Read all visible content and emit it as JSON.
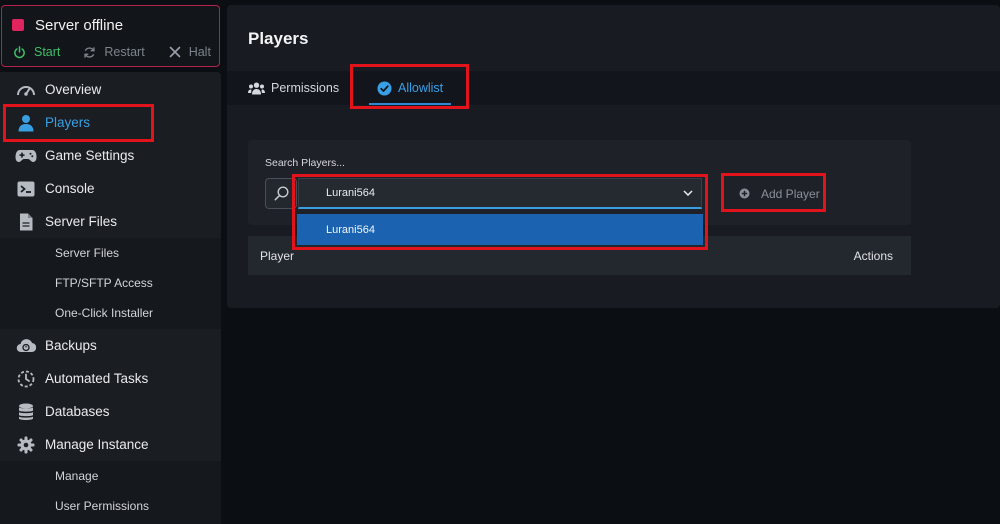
{
  "server": {
    "status": "Server offline"
  },
  "power": {
    "start": "Start",
    "restart": "Restart",
    "halt": "Halt"
  },
  "sidebar": {
    "overview": "Overview",
    "players": "Players",
    "game_settings": "Game Settings",
    "console": "Console",
    "server_files": "Server Files",
    "server_files_sub": [
      "Server Files",
      "FTP/SFTP Access",
      "One-Click Installer"
    ],
    "backups": "Backups",
    "automated_tasks": "Automated Tasks",
    "databases": "Databases",
    "manage_instance": "Manage Instance",
    "manage_sub": [
      "Manage",
      "User Permissions"
    ]
  },
  "main": {
    "title": "Players",
    "tabs": [
      "Permissions",
      "Allowlist"
    ],
    "search_label": "Search Players...",
    "select_value": "Lurani564",
    "dropdown_option": "Lurani564",
    "add_button": "Add Player",
    "columns": [
      "Player",
      "Actions"
    ]
  },
  "colors": {
    "accent": "#3a9fe0",
    "status": "#e0245e",
    "start": "#3fbf6a",
    "highlight": "#e2131b"
  }
}
